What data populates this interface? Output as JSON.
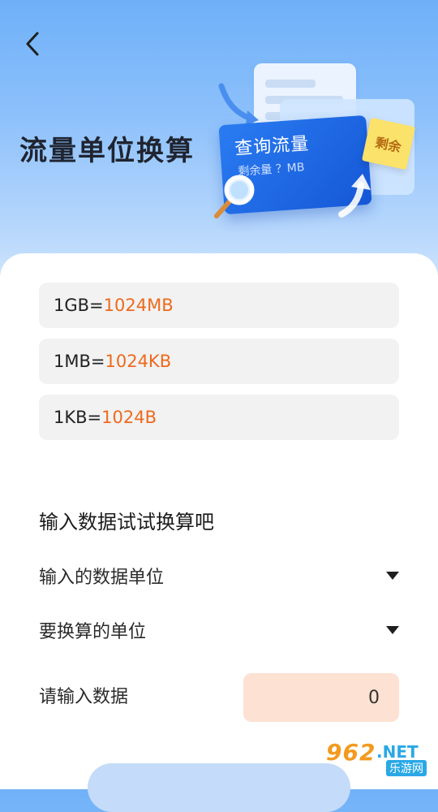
{
  "header": {
    "title": "流量单位换算"
  },
  "hero": {
    "card_title": "查询流量",
    "card_sub": "剩余量 ？MB",
    "note": "剩余"
  },
  "conversions": [
    {
      "lhs": "1GB=",
      "rhs": "1024MB"
    },
    {
      "lhs": "1MB=",
      "rhs": "1024KB"
    },
    {
      "lhs": "1KB=",
      "rhs": "1024B"
    }
  ],
  "form": {
    "section_title": "输入数据试试换算吧",
    "from_unit_label": "输入的数据单位",
    "to_unit_label": "要换算的单位",
    "input_label": "请输入数据",
    "input_value": "0"
  },
  "watermark": {
    "num": "962",
    "dot": ".NET",
    "sub": "乐游网"
  },
  "colors": {
    "accent": "#ee6a1d",
    "input_bg": "#fde1d2",
    "row_bg": "#f2f2f2",
    "header_blue": "#6eb0f8"
  }
}
